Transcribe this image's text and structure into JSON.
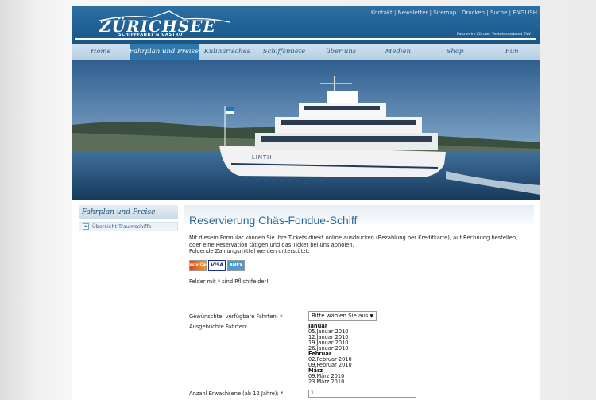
{
  "header": {
    "logo_text": "ZÜRICHSEE",
    "logo_sub": "SCHIFFFAHRT & GASTRO",
    "top_links": [
      "Kontakt",
      "Newsletter",
      "Sitemap",
      "Drucken",
      "Suche",
      "ENGLISH"
    ],
    "partner": "Partner im Zürcher Verkehrsverbund ZVV"
  },
  "nav": {
    "items": [
      "Home",
      "Fahrplan und Preise",
      "Kulinarisches",
      "Schiffsmiete",
      "über uns",
      "Medien",
      "Shop",
      "Fun"
    ],
    "active": "Fahrplan und Preise"
  },
  "hero": {
    "ship_name": "LINTH"
  },
  "sidebar": {
    "title": "Fahrplan und Preise",
    "items": [
      "Übersicht Traumschiffe"
    ]
  },
  "content": {
    "title": "Reservierung Chäs-Fondue-Schiff",
    "intro_1": "Mit diesem Formular können Sie Ihre Tickets direkt online ausdrucken (Bezahlung per Kreditkarte), auf Rechnung bestellen, oder eine Reservation tätigen und das Ticket bei uns abholen.",
    "intro_2": "Folgende Zahlungsmittel werden unterstützt:",
    "payment": [
      "MasterCard",
      "VISA",
      "AMEX"
    ],
    "required_note": "Felder mit * sind Pflichtfelder!",
    "fahrten_label": "Gewünschte, verfügbare Fahrten: *",
    "fahrten_value": "Bitte wählen Sie aus",
    "booked_label": "Ausgebuchte Fahrten:",
    "booked": [
      {
        "month": "Januar",
        "dates": [
          "05.Januar 2010",
          "12.Januar 2010",
          "19.Januar 2010",
          "26.Januar 2010"
        ]
      },
      {
        "month": "Februar",
        "dates": [
          "02.Februar 2010",
          "09.Februar 2010"
        ]
      },
      {
        "month": "März",
        "dates": [
          "09.März 2010",
          "23.März 2010"
        ]
      }
    ],
    "adults_label": "Anzahl Erwachsene (ab 12 Jahre): *",
    "adults_value": "1"
  },
  "colors": {
    "header_blue": "#1f5f94",
    "nav_active": "#2e78ad",
    "title_blue": "#2f6a9a"
  }
}
